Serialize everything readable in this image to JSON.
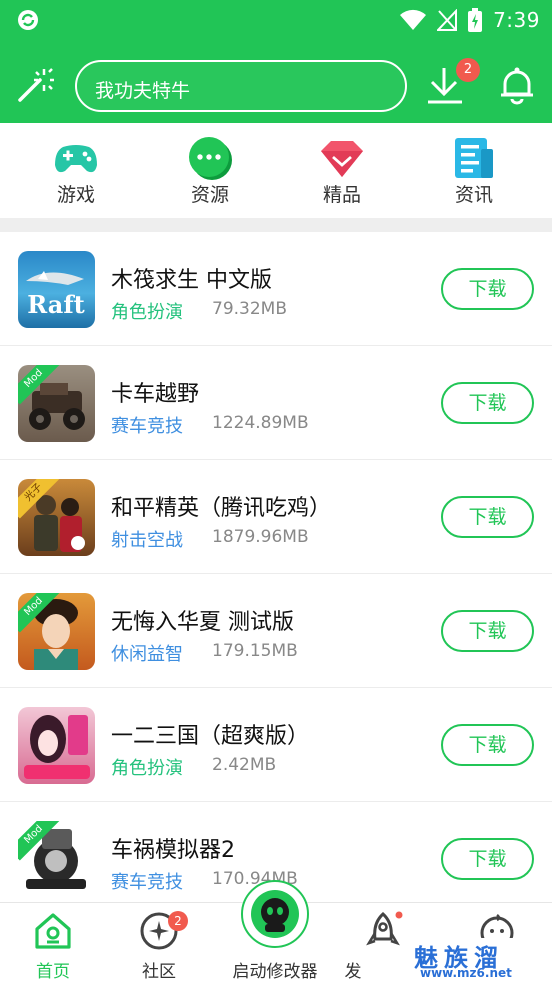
{
  "status_bar": {
    "time": "7:39",
    "colors": {
      "bg": "#21c556"
    }
  },
  "header": {
    "search": {
      "text": "我功夫特牛"
    },
    "download_badge": "2",
    "icons": [
      "magic-wand-icon",
      "download-icon",
      "bell-icon"
    ]
  },
  "categories": [
    {
      "label": "游戏",
      "icon": "gamepad-icon",
      "color": "#26c6a6"
    },
    {
      "label": "资源",
      "icon": "chat-bubble-icon",
      "color": "#21c556"
    },
    {
      "label": "精品",
      "icon": "diamond-icon",
      "color": "#f2546b"
    },
    {
      "label": "资讯",
      "icon": "news-icon",
      "color": "#2ab8e6"
    }
  ],
  "apps": [
    {
      "title": "木筏求生  中文版",
      "category": "角色扮演",
      "category_color": "#25c27e",
      "size": "79.32MB",
      "button": "下载",
      "thumb": "raft"
    },
    {
      "title": "卡车越野",
      "category": "赛车竞技",
      "category_color": "#3f8fe0",
      "size": "1224.89MB",
      "button": "下载",
      "thumb": "truck",
      "tag": "Mod"
    },
    {
      "title": "和平精英（腾讯吃鸡）",
      "category": "射击空战",
      "category_color": "#3f8fe0",
      "size": "1879.96MB",
      "button": "下载",
      "thumb": "pubg",
      "tag": "光子"
    },
    {
      "title": "无悔入华夏  测试版",
      "category": "休闲益智",
      "category_color": "#3f8fe0",
      "size": "179.15MB",
      "button": "下载",
      "thumb": "china",
      "tag": "Mod"
    },
    {
      "title": "一二三国（超爽版）",
      "category": "角色扮演",
      "category_color": "#25c27e",
      "size": "2.42MB",
      "button": "下载",
      "thumb": "sanguo"
    },
    {
      "title": "车祸模拟器2",
      "category": "赛车竞技",
      "category_color": "#3f8fe0",
      "size": "170.94MB",
      "button": "下载",
      "thumb": "wheel",
      "tag": "Mod"
    }
  ],
  "bottom_nav": [
    {
      "label": "首页",
      "icon": "home-icon",
      "active": true
    },
    {
      "label": "社区",
      "icon": "community-icon",
      "badge": "2"
    },
    {
      "label": "启动修改器",
      "icon": "launcher-icon"
    },
    {
      "label": "发",
      "icon": "rocket-icon"
    },
    {
      "label": "",
      "icon": "face-icon"
    }
  ],
  "watermark": {
    "title": "魅族溜",
    "url": "www.mz6.net"
  }
}
